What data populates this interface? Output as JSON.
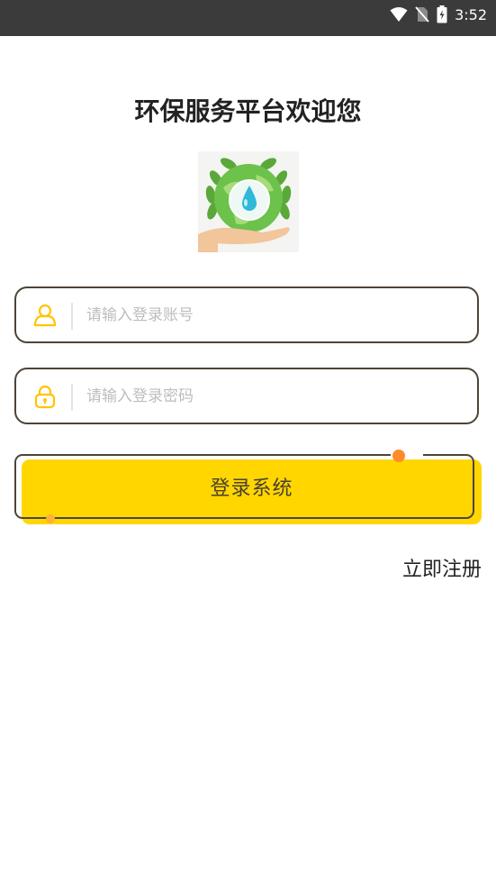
{
  "status_bar": {
    "time": "3:52",
    "icons": [
      "wifi-icon",
      "no-sim-icon",
      "battery-charging-icon"
    ]
  },
  "page": {
    "title": "环保服务平台欢迎您"
  },
  "logo": {
    "icon": "earth-water-drop-hand-logo"
  },
  "account_field": {
    "icon": "user-icon",
    "placeholder": "请输入登录账号",
    "value": ""
  },
  "password_field": {
    "icon": "lock-icon",
    "placeholder": "请输入登录密码",
    "value": ""
  },
  "login_button": {
    "label": "登录系统"
  },
  "register_link": {
    "label": "立即注册"
  },
  "colors": {
    "accent_yellow": "#FFD600",
    "border_brown": "#4E4438",
    "dot_orange": "#FF8A2B",
    "status_bar_bg": "#3B3B3B"
  }
}
